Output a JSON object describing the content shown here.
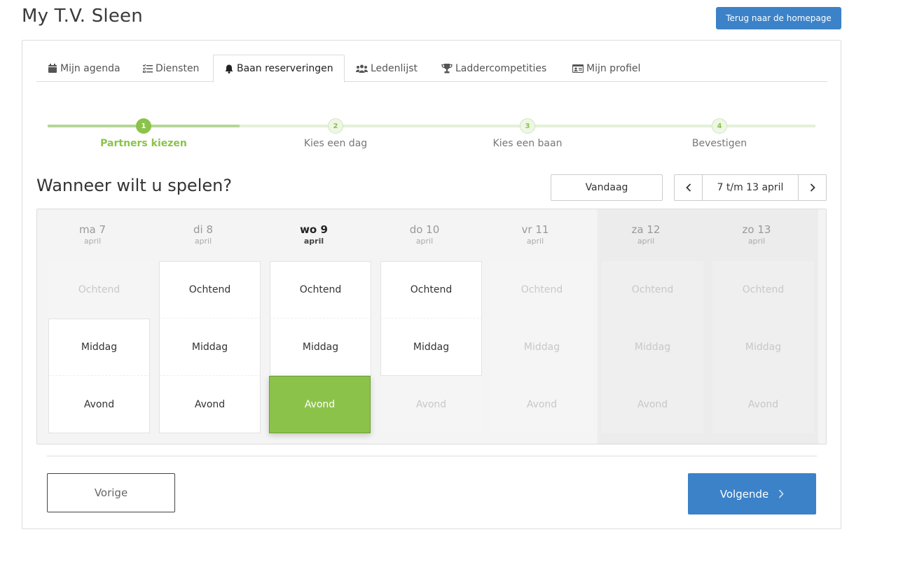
{
  "header": {
    "title": "My T.V. Sleen",
    "home_button": "Terug naar de homepage"
  },
  "tabs": [
    {
      "label": "Mijn agenda",
      "icon": "calendar-icon"
    },
    {
      "label": "Diensten",
      "icon": "tasks-icon"
    },
    {
      "label": "Baan reserveringen",
      "icon": "bell-icon",
      "active": true
    },
    {
      "label": "Ledenlijst",
      "icon": "users-icon"
    },
    {
      "label": "Laddercompetities",
      "icon": "trophy-icon"
    },
    {
      "label": "Mijn profiel",
      "icon": "id-card-icon"
    }
  ],
  "steps": [
    {
      "number": "1",
      "label": "Partners kiezen",
      "state": "current"
    },
    {
      "number": "2",
      "label": "Kies een dag",
      "state": "todo"
    },
    {
      "number": "3",
      "label": "Kies een baan",
      "state": "todo"
    },
    {
      "number": "4",
      "label": "Bevestigen",
      "state": "todo"
    }
  ],
  "question": "Wanneer wilt u spelen?",
  "today_button": "Vandaag",
  "range_label": "7 t/m 13 april",
  "days": [
    {
      "name": "ma 7",
      "month": "april",
      "slots": [
        "dis",
        "avail",
        "avail"
      ]
    },
    {
      "name": "di 8",
      "month": "april",
      "slots": [
        "avail",
        "avail",
        "avail"
      ]
    },
    {
      "name": "wo 9",
      "month": "april",
      "today": true,
      "slots": [
        "avail",
        "avail",
        "sel"
      ]
    },
    {
      "name": "do 10",
      "month": "april",
      "slots": [
        "avail",
        "avail",
        "dis"
      ]
    },
    {
      "name": "vr 11",
      "month": "april",
      "slots": [
        "dis",
        "dis",
        "dis"
      ]
    },
    {
      "name": "za 12",
      "month": "april",
      "weekend": true,
      "slots": [
        "dis",
        "dis",
        "dis"
      ]
    },
    {
      "name": "zo 13",
      "month": "april",
      "weekend": true,
      "slots": [
        "dis",
        "dis",
        "dis"
      ]
    }
  ],
  "slot_labels": [
    "Ochtend",
    "Middag",
    "Avond"
  ],
  "footer": {
    "prev_label": "Vorige",
    "next_label": "Volgende"
  },
  "colors": {
    "primary": "#3b82c8",
    "accent_green": "#8bc34a"
  }
}
